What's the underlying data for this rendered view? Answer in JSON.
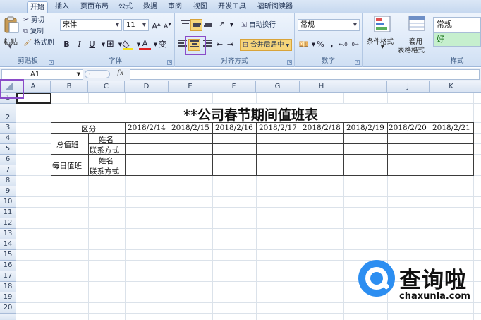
{
  "ribbon_tabs": [
    {
      "label": "开始",
      "active": true
    },
    {
      "label": "插入",
      "active": false
    },
    {
      "label": "页面布局",
      "active": false
    },
    {
      "label": "公式",
      "active": false
    },
    {
      "label": "数据",
      "active": false
    },
    {
      "label": "审阅",
      "active": false
    },
    {
      "label": "视图",
      "active": false
    },
    {
      "label": "开发工具",
      "active": false
    },
    {
      "label": "福昕阅读器",
      "active": false
    }
  ],
  "clipboard": {
    "paste_label": "粘贴",
    "cut_label": "剪切",
    "copy_label": "复制",
    "format_painter_label": "格式刷",
    "group_label": "剪贴板"
  },
  "font": {
    "font_name": "宋体",
    "font_size": "11",
    "bold": "B",
    "italic": "I",
    "underline": "U",
    "grow": "A",
    "shrink": "A",
    "font_color_glyph": "A",
    "phonetic_glyph": "变",
    "group_label": "字体"
  },
  "alignment": {
    "wrap_text_label": "自动换行",
    "merge_center_label": "合并后居中",
    "group_label": "对齐方式"
  },
  "number": {
    "format": "常规",
    "percent": "%",
    "comma": ",",
    "group_label": "数字"
  },
  "styles": {
    "conditional_format_label": "条件格式",
    "format_as_table_line1": "套用",
    "format_as_table_line2": "表格格式",
    "style_normal": "常规",
    "style_good": "好",
    "group_label": "样式"
  },
  "formula_bar": {
    "name_box": "A1",
    "fx": "fx",
    "formula": ""
  },
  "colors": {
    "accent_purple": "#8a4bc8",
    "watermark_blue": "#2c8ef1"
  },
  "columns": [
    "A",
    "B",
    "C",
    "D",
    "E",
    "F",
    "G",
    "H",
    "I",
    "J",
    "K"
  ],
  "rows": [
    "1",
    "2",
    "3",
    "4",
    "5",
    "6",
    "7",
    "8",
    "9",
    "10",
    "11",
    "12",
    "13",
    "14",
    "15",
    "16",
    "17",
    "18",
    "19",
    "20"
  ],
  "sheet": {
    "title": "**公司春节期间值班表",
    "header_label": "区分",
    "dates": [
      "2018/2/14",
      "2018/2/15",
      "2018/2/16",
      "2018/2/17",
      "2018/2/18",
      "2018/2/19",
      "2018/2/20",
      "2018/2/21"
    ],
    "groups": [
      {
        "label": "总值班",
        "fields": [
          "姓名",
          "联系方式"
        ]
      },
      {
        "label": "每日值班",
        "fields": [
          "姓名",
          "联系方式"
        ]
      }
    ]
  },
  "watermark": {
    "text": "查询啦",
    "domain": "chaxunla.com"
  }
}
